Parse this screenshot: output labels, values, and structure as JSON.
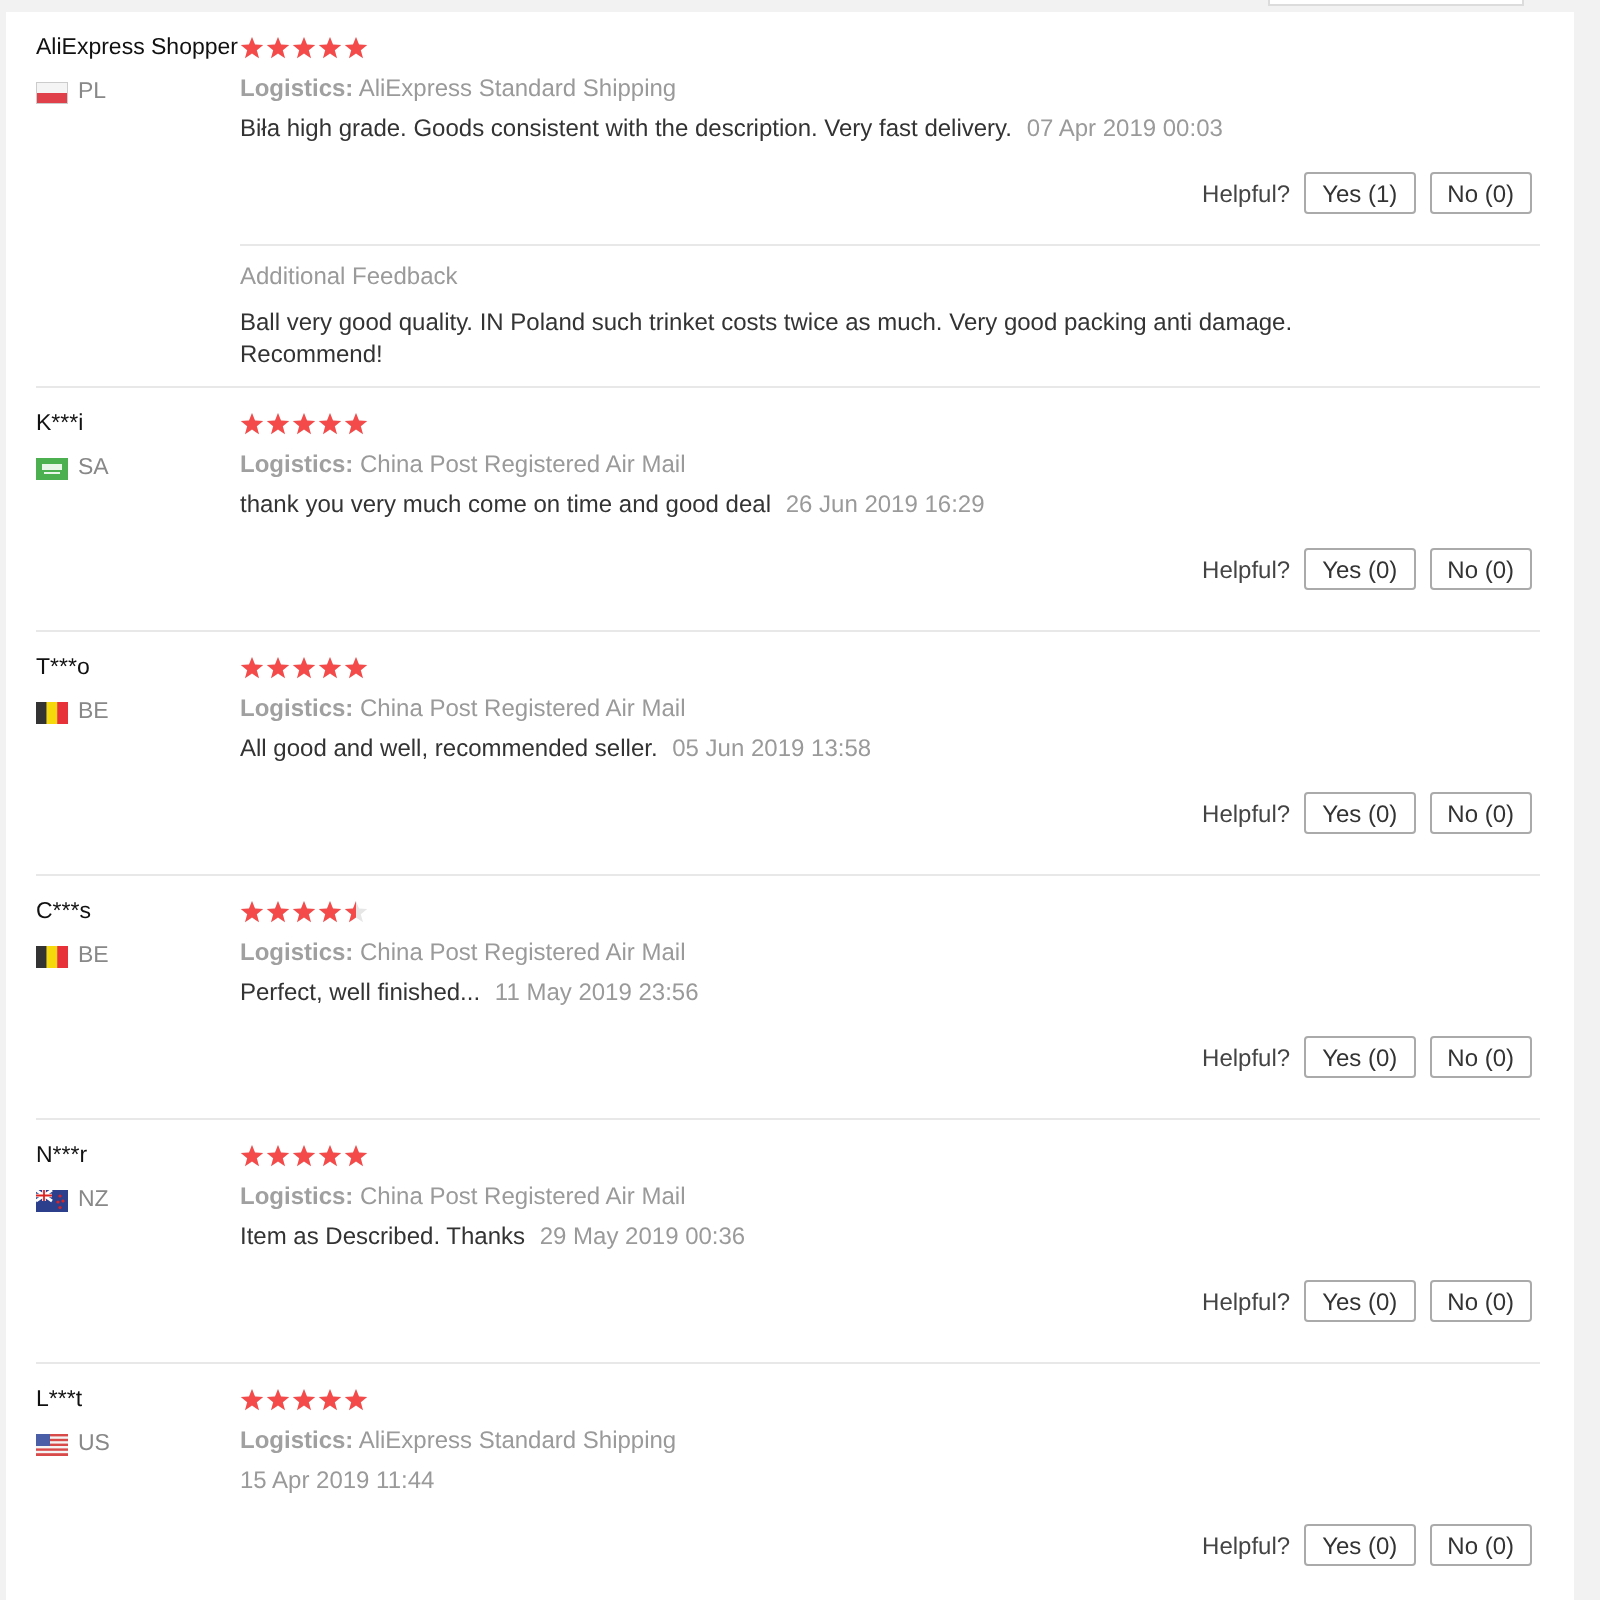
{
  "reviews": [
    {
      "name": "AliExpress Shopper",
      "country": "PL",
      "stars": 5,
      "logistics": {
        "label": "Logistics:",
        "value": "AliExpress Standard Shipping"
      },
      "comment": "Biła high grade. Goods consistent with the description. Very fast delivery.",
      "date": "07 Apr 2019 00:03",
      "helpful": {
        "label": "Helpful?",
        "yes": "Yes (1)",
        "no": "No (0)"
      },
      "additional_feedback": {
        "title": "Additional Feedback",
        "text": "Ball very good quality. IN Poland such trinket costs twice as much. Very good packing anti damage. Recommend!"
      }
    },
    {
      "name": "K***i",
      "country": "SA",
      "stars": 5,
      "logistics": {
        "label": "Logistics:",
        "value": "China Post Registered Air Mail"
      },
      "comment": "thank you very much come on time and good deal",
      "date": "26 Jun 2019 16:29",
      "helpful": {
        "label": "Helpful?",
        "yes": "Yes (0)",
        "no": "No (0)"
      }
    },
    {
      "name": "T***o",
      "country": "BE",
      "stars": 5,
      "logistics": {
        "label": "Logistics:",
        "value": "China Post Registered Air Mail"
      },
      "comment": "All good and well, recommended seller.",
      "date": "05 Jun 2019 13:58",
      "helpful": {
        "label": "Helpful?",
        "yes": "Yes (0)",
        "no": "No (0)"
      }
    },
    {
      "name": "C***s",
      "country": "BE",
      "stars": 4.5,
      "logistics": {
        "label": "Logistics:",
        "value": "China Post Registered Air Mail"
      },
      "comment": "Perfect, well finished...",
      "date": "11 May 2019 23:56",
      "helpful": {
        "label": "Helpful?",
        "yes": "Yes (0)",
        "no": "No (0)"
      }
    },
    {
      "name": "N***r",
      "country": "NZ",
      "stars": 5,
      "logistics": {
        "label": "Logistics:",
        "value": "China Post Registered Air Mail"
      },
      "comment": "Item as Described. Thanks",
      "date": "29 May 2019 00:36",
      "helpful": {
        "label": "Helpful?",
        "yes": "Yes (0)",
        "no": "No (0)"
      }
    },
    {
      "name": "L***t",
      "country": "US",
      "stars": 5,
      "logistics": {
        "label": "Logistics:",
        "value": "AliExpress Standard Shipping"
      },
      "date": "15 Apr 2019 11:44",
      "helpful": {
        "label": "Helpful?",
        "yes": "Yes (0)",
        "no": "No (0)"
      }
    }
  ]
}
